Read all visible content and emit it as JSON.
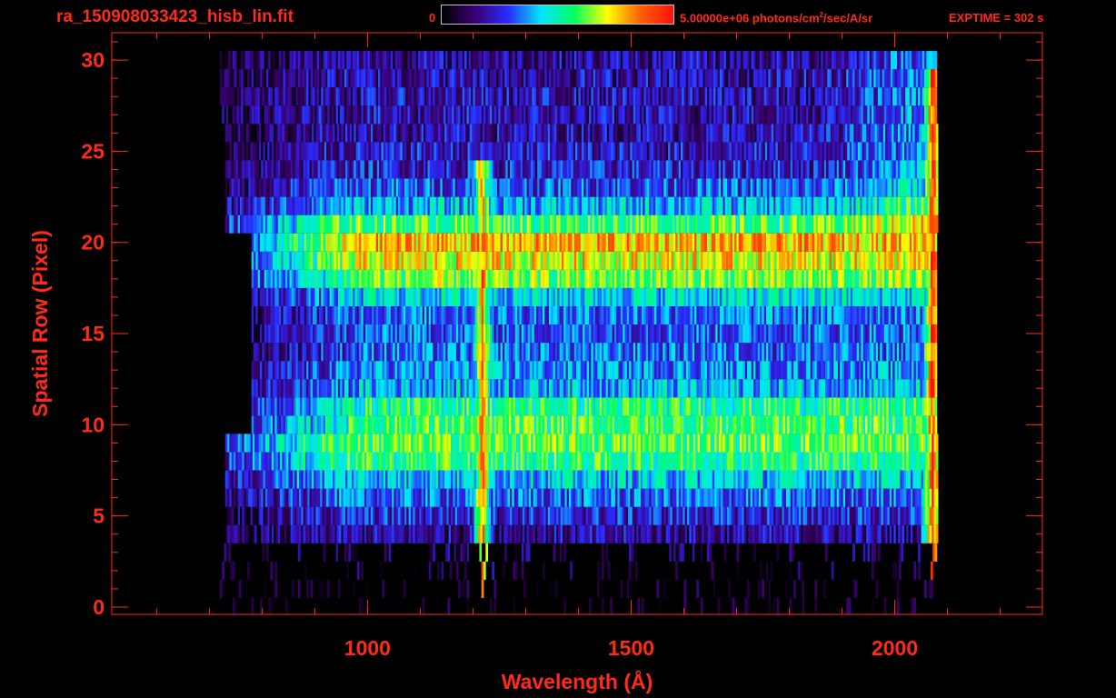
{
  "header": {
    "filename": "ra_150908033423_hisb_lin.fit",
    "colorbar_min": "0",
    "colorbar_max_prefix": "5.00000e+06 photons/cm",
    "colorbar_max_exp": "2",
    "colorbar_max_suffix": "/sec/A/sr",
    "exptime": "EXPTIME = 302 s"
  },
  "colors": {
    "text": "#ff2a1a",
    "axes": "#ff2a1a",
    "background": "#000000",
    "colormap": [
      "#000000",
      "#3a0070",
      "#2a2aff",
      "#00e5ff",
      "#00ff60",
      "#ffff00",
      "#ff6000",
      "#ff1010"
    ]
  },
  "chart_data": {
    "type": "heatmap",
    "title": "",
    "xlabel": "Wavelength (Å)",
    "ylabel": "Spatial Row (Pixel)",
    "xlim": [
      515,
      2280
    ],
    "ylim": [
      -0.4,
      31.5
    ],
    "x_ticks": [
      "1000",
      "1500",
      "2000"
    ],
    "y_ticks": [
      "0",
      "5",
      "10",
      "15",
      "20",
      "25",
      "30"
    ],
    "x_tick_values": [
      1000,
      1500,
      2000
    ],
    "y_tick_values": [
      0,
      5,
      10,
      15,
      20,
      25,
      30
    ],
    "x_minor_step": 100,
    "y_minor_step": 1,
    "colorbar_range": [
      0,
      5000000
    ],
    "colorbar_units": "photons/cm2/sec/A/sr",
    "data_extent": {
      "x": [
        690,
        2080
      ],
      "rows": [
        0,
        30
      ]
    },
    "rows": [
      {
        "row": 0,
        "level": 0.02
      },
      {
        "row": 1,
        "level": 0.03
      },
      {
        "row": 2,
        "level": 0.05
      },
      {
        "row": 3,
        "level": 0.1
      },
      {
        "row": 4,
        "level": 0.18
      },
      {
        "row": 5,
        "level": 0.25
      },
      {
        "row": 6,
        "level": 0.32
      },
      {
        "row": 7,
        "level": 0.42
      },
      {
        "row": 8,
        "level": 0.55
      },
      {
        "row": 9,
        "level": 0.6
      },
      {
        "row": 10,
        "level": 0.58
      },
      {
        "row": 11,
        "level": 0.54
      },
      {
        "row": 12,
        "level": 0.4
      },
      {
        "row": 13,
        "level": 0.36
      },
      {
        "row": 14,
        "level": 0.33
      },
      {
        "row": 15,
        "level": 0.32
      },
      {
        "row": 16,
        "level": 0.34
      },
      {
        "row": 17,
        "level": 0.44
      },
      {
        "row": 18,
        "level": 0.62
      },
      {
        "row": 19,
        "level": 0.72
      },
      {
        "row": 20,
        "level": 0.78
      },
      {
        "row": 21,
        "level": 0.58
      },
      {
        "row": 22,
        "level": 0.4
      },
      {
        "row": 23,
        "level": 0.3
      },
      {
        "row": 24,
        "level": 0.24
      },
      {
        "row": 25,
        "level": 0.22
      },
      {
        "row": 26,
        "level": 0.2
      },
      {
        "row": 27,
        "level": 0.2
      },
      {
        "row": 28,
        "level": 0.2
      },
      {
        "row": 29,
        "level": 0.2
      },
      {
        "row": 30,
        "level": 0.18
      }
    ],
    "emission_lines": [
      {
        "wavelength": 1216,
        "rows": [
          1,
          24
        ],
        "strength": 0.85
      },
      {
        "wavelength": 2070,
        "rows": [
          2,
          29
        ],
        "strength": 0.95
      }
    ]
  }
}
